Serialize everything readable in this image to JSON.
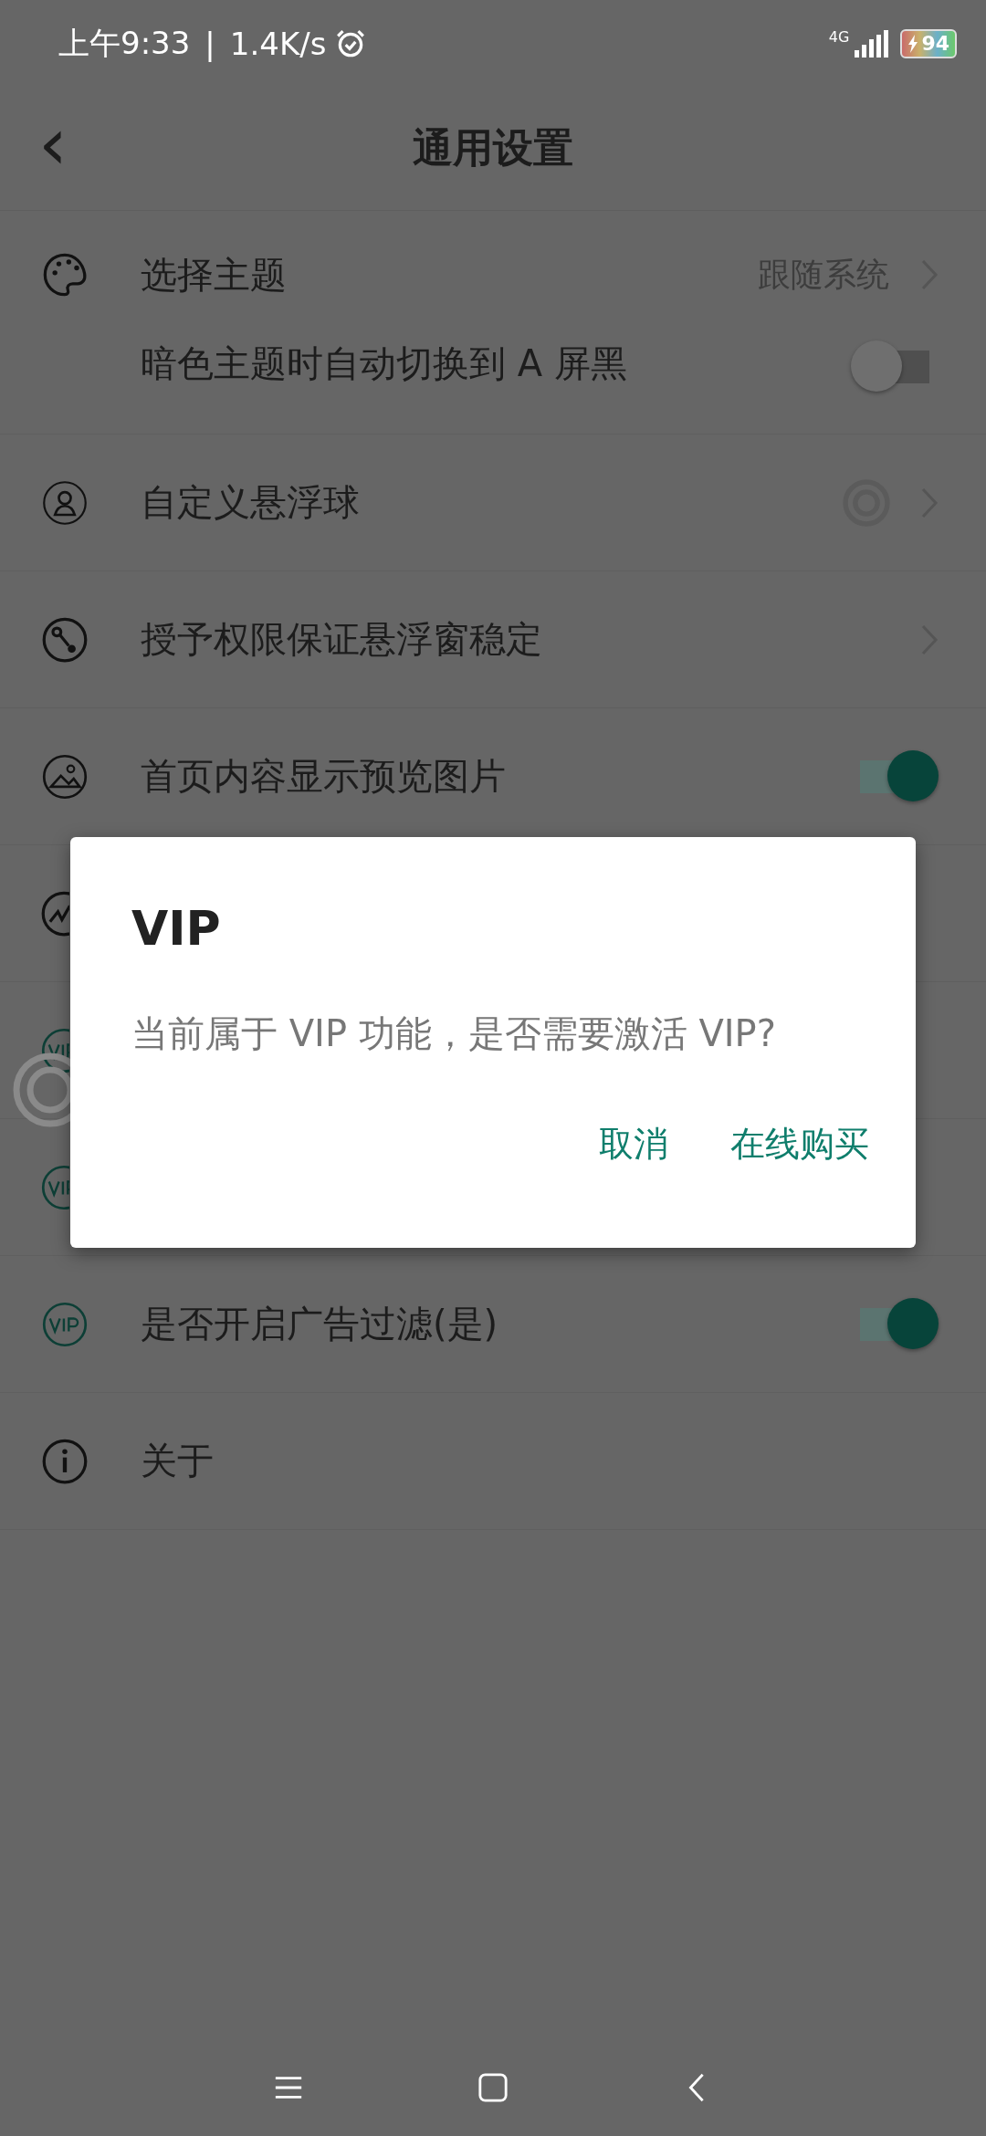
{
  "status_bar": {
    "time": "上午9:33",
    "separator": "|",
    "speed": "1.4K/s",
    "network": "4G",
    "battery": "94"
  },
  "header": {
    "back": "‹",
    "title": "通用设置"
  },
  "rows": [
    {
      "kind": "nav",
      "label": "选择主题",
      "value": "跟随系统"
    },
    {
      "kind": "toggle",
      "label": "暗色主题时自动切换到 A 屏黑",
      "on": false
    },
    {
      "kind": "nav-ring",
      "label": "自定义悬浮球"
    },
    {
      "kind": "nav",
      "label": "授予权限保证悬浮窗稳定"
    },
    {
      "kind": "toggle",
      "label": "首页内容显示预览图片",
      "on": true
    },
    {
      "kind": "covered"
    },
    {
      "kind": "covered"
    },
    {
      "kind": "covered"
    },
    {
      "kind": "toggle",
      "label": "是否开启广告过滤(是)",
      "on": true
    },
    {
      "kind": "plain",
      "label": "关于"
    }
  ],
  "dialog": {
    "title": "VIP",
    "message": "当前属于 VIP 功能，是否需要激活 VIP?",
    "buttons": [
      "取消",
      "在线购买"
    ]
  }
}
